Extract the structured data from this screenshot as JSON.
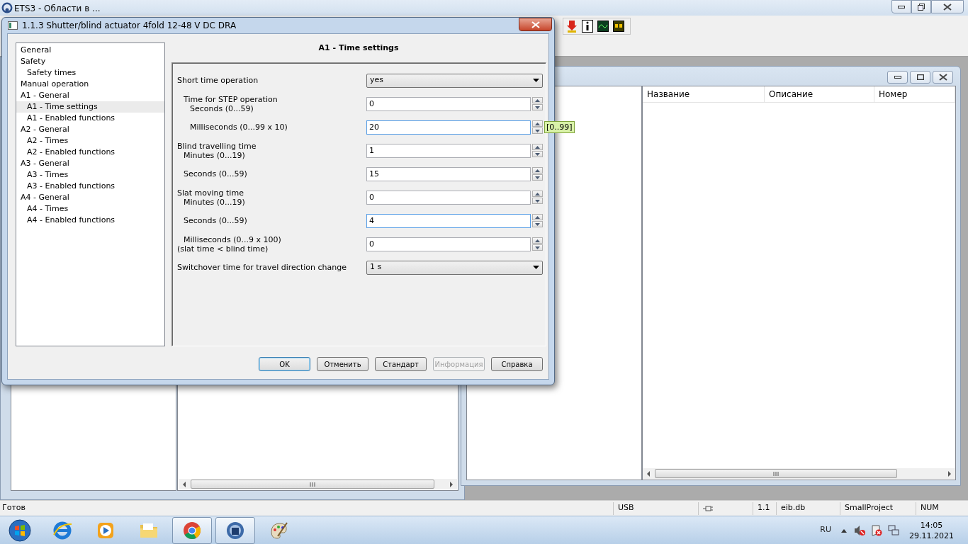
{
  "app": {
    "title": "ETS3 - Области в ..."
  },
  "dialog": {
    "title": "1.1.3 Shutter/blind actuator 4fold 12-48 V DC DRA",
    "tree": [
      {
        "label": "General",
        "selected": false
      },
      {
        "label": "Safety",
        "selected": false,
        "children": [
          {
            "label": "Safety times",
            "selected": false
          }
        ]
      },
      {
        "label": "Manual operation",
        "selected": false
      },
      {
        "label": "A1 - General",
        "selected": false,
        "children": [
          {
            "label": "A1 - Time settings",
            "selected": true
          },
          {
            "label": "A1 - Enabled functions",
            "selected": false
          }
        ]
      },
      {
        "label": "A2 - General",
        "selected": false,
        "children": [
          {
            "label": "A2 - Times",
            "selected": false
          },
          {
            "label": "A2 - Enabled functions",
            "selected": false
          }
        ]
      },
      {
        "label": "A3 - General",
        "selected": false,
        "children": [
          {
            "label": "A3 - Times",
            "selected": false
          },
          {
            "label": "A3 - Enabled functions",
            "selected": false
          }
        ]
      },
      {
        "label": "A4 - General",
        "selected": false,
        "children": [
          {
            "label": "A4 - Times",
            "selected": false
          },
          {
            "label": "A4 - Enabled functions",
            "selected": false
          }
        ]
      }
    ],
    "heading": "A1 - Time settings",
    "params": [
      {
        "label": "Short time operation",
        "kind": "select",
        "value": "yes",
        "children": [
          {
            "label": "Time for STEP operation",
            "kind": "group",
            "children": [
              {
                "label": "Seconds (0...59)",
                "kind": "spin",
                "value": "0",
                "focused": false
              },
              {
                "label": "Milliseconds (0...99 x 10)",
                "kind": "spin",
                "value": "20",
                "focused": true,
                "hint": "[0..99]"
              }
            ]
          }
        ]
      },
      {
        "label": "Blind travelling time",
        "kind": "group",
        "children": [
          {
            "label": "Minutes (0...19)",
            "kind": "spin",
            "value": "1",
            "focused": false
          },
          {
            "label": "Seconds (0...59)",
            "kind": "spin",
            "value": "15",
            "focused": false
          }
        ]
      },
      {
        "label": "Slat moving time",
        "kind": "group",
        "children": [
          {
            "label": "Minutes (0...19)",
            "kind": "spin",
            "value": "0",
            "focused": false
          },
          {
            "label": "Seconds (0...59)",
            "kind": "spin",
            "value": "4",
            "focused": true
          },
          {
            "label": "Milliseconds (0...9 x 100)",
            "kind": "spin",
            "value": "0",
            "focused": false,
            "note": "(slat time < blind time)"
          }
        ]
      },
      {
        "label": "Switchover time for travel direction change",
        "kind": "select",
        "value": "1 s"
      }
    ],
    "buttons": [
      {
        "label": "OK",
        "default": true,
        "disabled": false
      },
      {
        "label": "Отменить",
        "default": false,
        "disabled": false
      },
      {
        "label": "Стандарт",
        "default": false,
        "disabled": false
      },
      {
        "label": "Информация",
        "default": false,
        "disabled": true
      },
      {
        "label": "Справка",
        "default": false,
        "disabled": false
      }
    ]
  },
  "table": {
    "columns": [
      "Название",
      "Описание",
      "Номер"
    ]
  },
  "status_bar": [
    "Готов",
    "USB",
    "1.1",
    "eib.db",
    "SmallProject",
    "NUM"
  ],
  "taskbar": {
    "language": "RU",
    "time": "14:05",
    "date": "29.11.2021"
  }
}
